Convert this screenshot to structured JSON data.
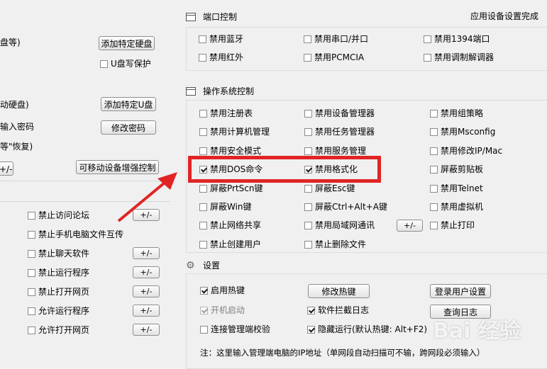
{
  "left": {
    "line1": "盘等)",
    "add_disk": "添加特定硬盘",
    "usb_protect": "U盘写保护",
    "line2": "动硬盘)",
    "add_usb": "添加特定U盘",
    "line3": "输入密码",
    "change_pwd": "修改密码",
    "line4": "等\"恢复)",
    "pm_short": "+/-",
    "mobile_enhance": "可移动设备增强控制",
    "items": [
      {
        "label": "禁止访问论坛",
        "pm": "+/-"
      },
      {
        "label": "禁止手机电脑文件互传",
        "pm": ""
      },
      {
        "label": "禁止聊天软件",
        "pm": "+/-"
      },
      {
        "label": "禁止运行程序",
        "pm": "+/-"
      },
      {
        "label": "禁止打开网页",
        "pm": "+/-"
      },
      {
        "label": "允许运行程序",
        "pm": "+/-"
      },
      {
        "label": "允许打开网页",
        "pm": "+/-"
      }
    ]
  },
  "port": {
    "title": "端口控制",
    "status": "应用设备设置完成",
    "items": [
      "禁用蓝牙",
      "禁用串口/并口",
      "禁用1394端口",
      "禁用红外",
      "禁用PCMCIA",
      "禁用调制解调器"
    ]
  },
  "os": {
    "title": "操作系统控制",
    "col1": [
      "禁用注册表",
      "禁用计算机管理",
      "禁用安全模式",
      "禁用DOS命令",
      "屏蔽PrtScn键",
      "屏蔽Win键",
      "禁止网络共享",
      "禁止创建用户"
    ],
    "col2": [
      "禁用设备管理器",
      "禁用任务管理器",
      "禁用服务管理",
      "禁用格式化",
      "屏蔽Esc键",
      "屏蔽Ctrl+Alt+A键",
      "禁用局域网通讯",
      "禁止删除文件"
    ],
    "col3": [
      "禁用组策略",
      "禁用Msconfig",
      "禁用修改IP/Mac",
      "屏蔽剪贴板",
      "禁用Telnet",
      "禁用虚拟机",
      "禁止打印"
    ],
    "pm": "+/-"
  },
  "settings": {
    "title": "设置",
    "hotkey": "启用热键",
    "edit_hotkey": "修改热键",
    "login_settings": "登录用户设置",
    "autostart": "开机启动",
    "intercept_log": "软件拦截日志",
    "query_log": "查询日志",
    "verify": "连接管理端校验",
    "hidden_run": "隐藏运行(默认热键: Alt+F2)",
    "note": "注：这里输入管理端电脑的IP地址（单网段自动扫描可不输，跨网段必须输入）"
  },
  "watermark": "Bai 经验",
  "colors": {
    "highlight": "#e02424",
    "arrow": "#e02424"
  }
}
